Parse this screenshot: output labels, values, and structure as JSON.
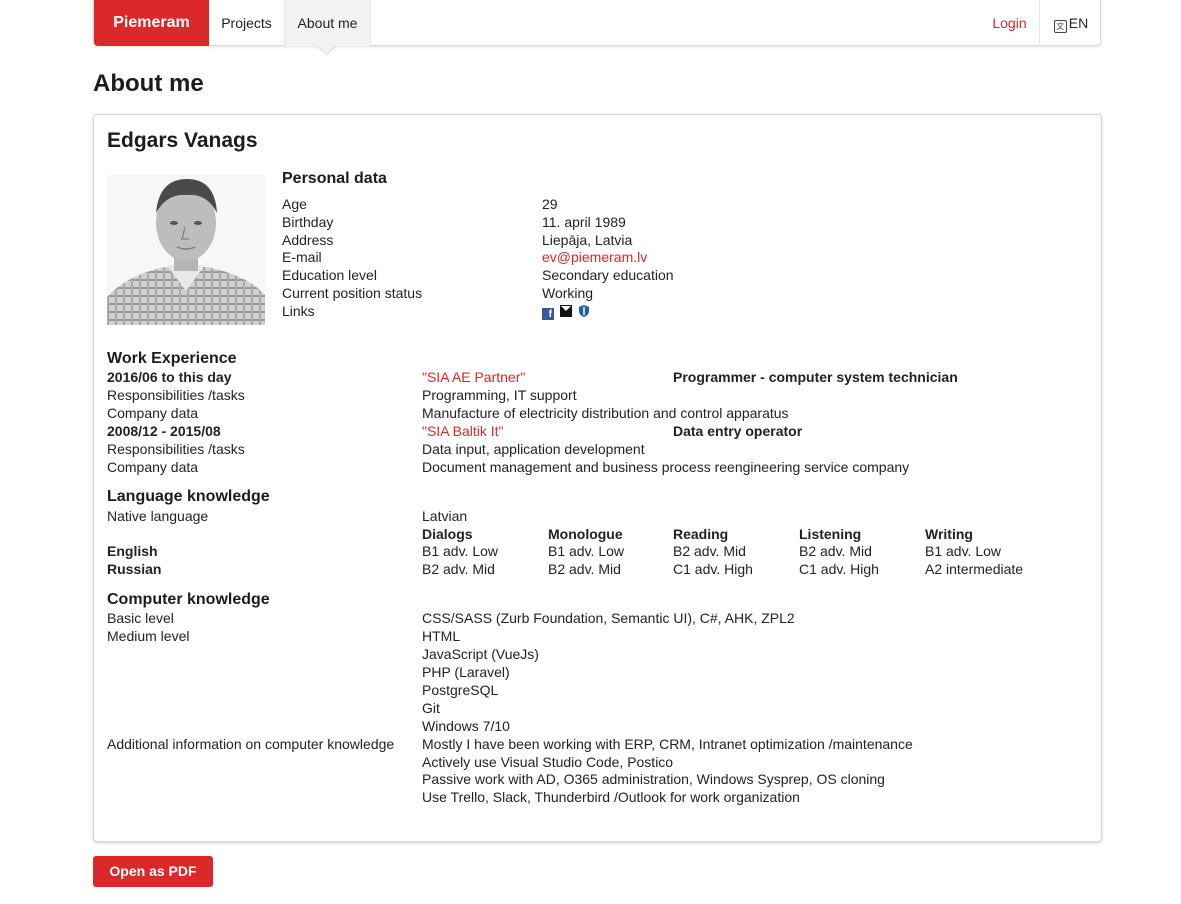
{
  "nav": {
    "brand": "Piemeram",
    "items": [
      {
        "label": "Projects"
      },
      {
        "label": "About me"
      }
    ],
    "login": "Login",
    "language": "EN"
  },
  "page_title": "About me",
  "cv": {
    "name": "Edgars Vanags",
    "personal": {
      "title": "Personal data",
      "rows": [
        {
          "label": "Age",
          "value": "29"
        },
        {
          "label": "Birthday",
          "value": "11. april 1989"
        },
        {
          "label": "Address",
          "value": "Liepāja, Latvia"
        },
        {
          "label": "E-mail",
          "value": "ev@piemeram.lv"
        },
        {
          "label": "Education level",
          "value": "Secondary education"
        },
        {
          "label": "Current position status",
          "value": "Working"
        },
        {
          "label": "Links",
          "value": ""
        }
      ],
      "link_icons": [
        "facebook-icon",
        "mail-icon",
        "shield-icon"
      ]
    },
    "work": {
      "title": "Work Experience",
      "jobs": [
        {
          "period": "2016/06 to this day",
          "company": "\"SIA AE Partner\"",
          "position": "Programmer - computer system technician",
          "resp_label": "Responsibilities /tasks",
          "resp": "Programming, IT support",
          "company_label": "Company data",
          "company_data": "Manufacture of electricity distribution and control apparatus"
        },
        {
          "period": "2008/12 - 2015/08",
          "company": "\"SIA Baltik It\"",
          "position": "Data entry operator",
          "resp_label": "Responsibilities /tasks",
          "resp": "Data input, application development",
          "company_label": "Company data",
          "company_data": "Document management and business process reengineering service company"
        }
      ]
    },
    "language": {
      "title": "Language knowledge",
      "native_label": "Native language",
      "native_value": "Latvian",
      "columns": [
        "Dialogs",
        "Monologue",
        "Reading",
        "Listening",
        "Writing"
      ],
      "rows": [
        {
          "name": "English",
          "levels": [
            "B1 adv. Low",
            "B1 adv. Low",
            "B2 adv. Mid",
            "B2 adv. Mid",
            "B1 adv. Low"
          ]
        },
        {
          "name": "Russian",
          "levels": [
            "B2 adv. Mid",
            "B2 adv. Mid",
            "C1 adv. High",
            "C1 adv. High",
            "A2 intermediate"
          ]
        }
      ]
    },
    "computer": {
      "title": "Computer knowledge",
      "basic_label": "Basic level",
      "basic_value": "CSS/SASS (Zurb Foundation, Semantic UI), C#, AHK, ZPL2",
      "medium_label": "Medium level",
      "medium_values": [
        "HTML",
        "JavaScript (VueJs)",
        "PHP (Laravel)",
        "PostgreSQL",
        "Git",
        "Windows 7/10"
      ],
      "additional_label": "Additional information on computer knowledge",
      "additional_values": [
        "Mostly I have been working with ERP, CRM, Intranet optimization /maintenance",
        "Actively use Visual Studio Code, Postico",
        "Passive work with AD, O365 administration, Windows Sysprep, OS cloning",
        "Use Trello, Slack, Thunderbird /Outlook for work organization"
      ]
    }
  },
  "pdf_button": "Open as PDF",
  "colors": {
    "accent": "#db2828",
    "facebook": "#3b5998"
  }
}
